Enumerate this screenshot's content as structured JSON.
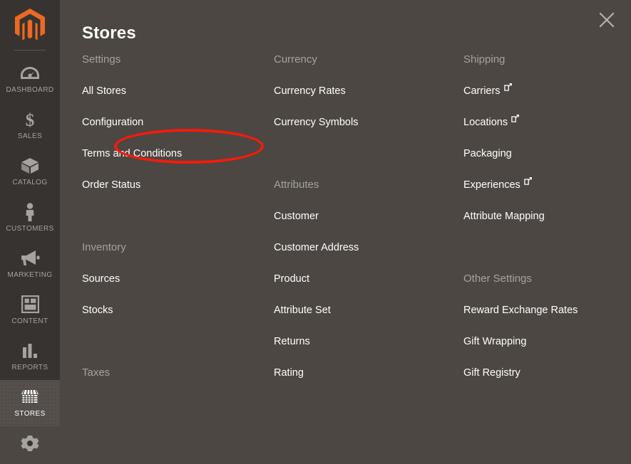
{
  "colors": {
    "sidebar_bg": "#373330",
    "panel_bg": "#4c4742",
    "active_bg": "#55504b",
    "group_title": "#a6a29e",
    "link_text": "#ffffff",
    "logo_orange": "#ec6922",
    "annotation_red": "#f41b0c"
  },
  "sidebar": {
    "logo_name": "magento-logo",
    "items": [
      {
        "label": "DASHBOARD",
        "icon": "dashboard-gauge-icon",
        "active": false
      },
      {
        "label": "SALES",
        "icon": "dollar-sign-icon",
        "active": false
      },
      {
        "label": "CATALOG",
        "icon": "box-icon",
        "active": false
      },
      {
        "label": "CUSTOMERS",
        "icon": "person-icon",
        "active": false
      },
      {
        "label": "MARKETING",
        "icon": "megaphone-icon",
        "active": false
      },
      {
        "label": "CONTENT",
        "icon": "layout-page-icon",
        "active": false
      },
      {
        "label": "REPORTS",
        "icon": "bar-chart-icon",
        "active": false
      },
      {
        "label": "STORES",
        "icon": "storefront-icon",
        "active": true
      },
      {
        "label": "",
        "icon": "system-gear-icon",
        "active": false
      }
    ]
  },
  "panel": {
    "title": "Stores",
    "close_icon": "close-icon",
    "columns": [
      {
        "id": "col-0",
        "blocks": [
          {
            "group": "Settings",
            "items": [
              {
                "label": "All Stores",
                "external": false
              },
              {
                "label": "Configuration",
                "external": false,
                "highlighted": true
              },
              {
                "label": "Terms and Conditions",
                "external": false
              },
              {
                "label": "Order Status",
                "external": false
              }
            ],
            "trailing_spacers": 1
          },
          {
            "group": "Inventory",
            "items": [
              {
                "label": "Sources",
                "external": false
              },
              {
                "label": "Stocks",
                "external": false
              }
            ],
            "trailing_spacers": 1
          },
          {
            "group": "Taxes",
            "items": [],
            "trailing_spacers": 0
          }
        ]
      },
      {
        "id": "col-1",
        "blocks": [
          {
            "group": "Currency",
            "items": [
              {
                "label": "Currency Rates",
                "external": false
              },
              {
                "label": "Currency Symbols",
                "external": false
              }
            ],
            "trailing_spacers": 1
          },
          {
            "group": "Attributes",
            "items": [
              {
                "label": "Customer",
                "external": false
              },
              {
                "label": "Customer Address",
                "external": false
              },
              {
                "label": "Product",
                "external": false
              },
              {
                "label": "Attribute Set",
                "external": false
              },
              {
                "label": "Returns",
                "external": false
              },
              {
                "label": "Rating",
                "external": false
              }
            ],
            "trailing_spacers": 0
          }
        ]
      },
      {
        "id": "col-2",
        "blocks": [
          {
            "group": "Shipping",
            "items": [
              {
                "label": "Carriers",
                "external": true
              },
              {
                "label": "Locations",
                "external": true
              },
              {
                "label": "Packaging",
                "external": false
              },
              {
                "label": "Experiences",
                "external": true
              },
              {
                "label": "Attribute Mapping",
                "external": false
              }
            ],
            "trailing_spacers": 1
          },
          {
            "group": "Other Settings",
            "items": [
              {
                "label": "Reward Exchange Rates",
                "external": false
              },
              {
                "label": "Gift Wrapping",
                "external": false
              },
              {
                "label": "Gift Registry",
                "external": false
              }
            ],
            "trailing_spacers": 0
          }
        ]
      }
    ]
  },
  "annotation": {
    "name": "configuration-highlight-ellipse",
    "target_label": "Configuration"
  }
}
